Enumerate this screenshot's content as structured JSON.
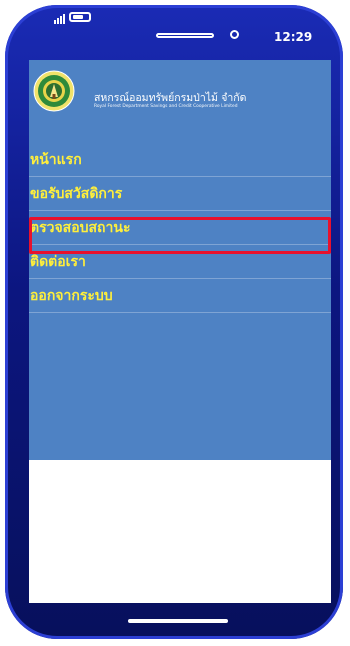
{
  "status_bar": {
    "time": "12:29"
  },
  "app": {
    "org_name_th": "สหกรณ์ออมทรัพย์กรมป่าไม้ จำกัด",
    "org_name_en": "Royal Forest Department Savings and Credit Cooperative Limited"
  },
  "menu": {
    "items": [
      {
        "label": "หน้าแรก"
      },
      {
        "label": "ขอรับสวัสดิการ"
      },
      {
        "label": "ตรวจสอบสถานะ"
      },
      {
        "label": "ติดต่อเรา"
      },
      {
        "label": "ออกจากระบบ"
      }
    ],
    "highlighted_index": 2
  },
  "colors": {
    "drawer_bg": "#4e82c4",
    "menu_text": "#ffef3b",
    "highlight_border": "#e8112d",
    "phone_frame": "#0c1680"
  }
}
